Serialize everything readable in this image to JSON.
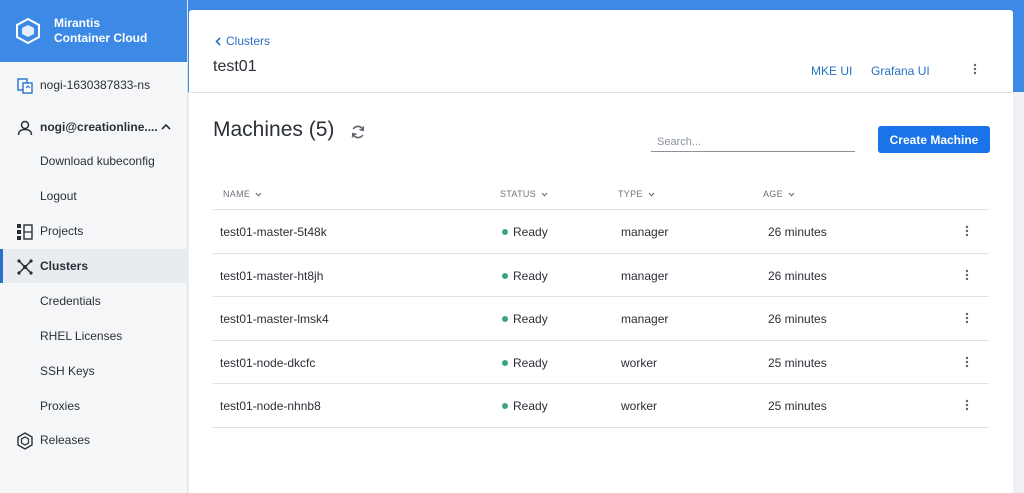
{
  "brand": {
    "line1": "Mirantis",
    "line2": "Container Cloud"
  },
  "sidebar": {
    "namespace": "nogi-1630387833-ns",
    "user": "nogi@creationline....",
    "items": [
      {
        "label": "Download kubeconfig"
      },
      {
        "label": "Logout"
      },
      {
        "label": "Projects"
      },
      {
        "label": "Clusters"
      },
      {
        "label": "Credentials"
      },
      {
        "label": "RHEL Licenses"
      },
      {
        "label": "SSH Keys"
      },
      {
        "label": "Proxies"
      },
      {
        "label": "Releases"
      }
    ]
  },
  "header": {
    "breadcrumb": "Clusters",
    "title": "test01",
    "links": {
      "mke": "MKE UI",
      "grafana": "Grafana UI"
    }
  },
  "machines": {
    "title": "Machines (5)",
    "search_placeholder": "Search...",
    "create_label": "Create Machine",
    "columns": {
      "name": "NAME",
      "status": "STATUS",
      "type": "TYPE",
      "age": "AGE"
    },
    "rows": [
      {
        "name": "test01-master-5t48k",
        "status": "Ready",
        "type": "manager",
        "age": "26 minutes"
      },
      {
        "name": "test01-master-ht8jh",
        "status": "Ready",
        "type": "manager",
        "age": "26 minutes"
      },
      {
        "name": "test01-master-lmsk4",
        "status": "Ready",
        "type": "manager",
        "age": "26 minutes"
      },
      {
        "name": "test01-node-dkcfc",
        "status": "Ready",
        "type": "worker",
        "age": "25 minutes"
      },
      {
        "name": "test01-node-nhnb8",
        "status": "Ready",
        "type": "worker",
        "age": "25 minutes"
      }
    ]
  },
  "colors": {
    "brand": "#3d8ae6",
    "primary_button": "#1a73e8",
    "link": "#2a70c8",
    "status_ready": "#3aa57a"
  }
}
